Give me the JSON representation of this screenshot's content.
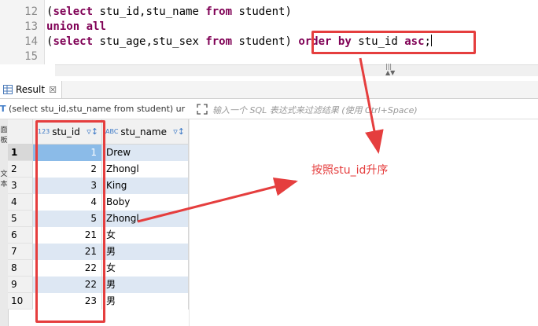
{
  "editor": {
    "lines": [
      {
        "num": "12",
        "parts": [
          {
            "t": "(",
            "k": false
          },
          {
            "t": "select",
            "k": true
          },
          {
            "t": " stu_id,stu_name ",
            "k": false
          },
          {
            "t": "from",
            "k": true
          },
          {
            "t": " student)",
            "k": false
          }
        ]
      },
      {
        "num": "13",
        "parts": [
          {
            "t": "union",
            "k": true
          },
          {
            "t": " ",
            "k": false
          },
          {
            "t": "all",
            "k": true
          }
        ]
      },
      {
        "num": "14",
        "parts": [
          {
            "t": "(",
            "k": false
          },
          {
            "t": "select",
            "k": true
          },
          {
            "t": " stu_age,stu_sex ",
            "k": false
          },
          {
            "t": "from",
            "k": true
          },
          {
            "t": " student) ",
            "k": false
          },
          {
            "t": "order",
            "k": true
          },
          {
            "t": " ",
            "k": false
          },
          {
            "t": "by",
            "k": true
          },
          {
            "t": " stu_id ",
            "k": false
          },
          {
            "t": "asc",
            "k": true
          },
          {
            "t": ";",
            "k": false
          }
        ]
      },
      {
        "num": "15",
        "parts": []
      }
    ],
    "scroll_marks": "|||\n▲▼"
  },
  "result_tab": {
    "label": "Result",
    "close_glyph": "☒"
  },
  "filter": {
    "query_text": "(select stu_id,stu_name from student) ur",
    "placeholder": "输入一个 SQL 表达式来过滤结果 (使用 Ctrl+Space)"
  },
  "side_strip": [
    "面板",
    "文本"
  ],
  "grid": {
    "columns": [
      {
        "label": "stu_id",
        "type_badge": "123"
      },
      {
        "label": "stu_name",
        "type_badge": "ABC"
      }
    ],
    "rows": [
      {
        "num": "1",
        "id": "1",
        "name": "Drew"
      },
      {
        "num": "2",
        "id": "2",
        "name": "Zhongl"
      },
      {
        "num": "3",
        "id": "3",
        "name": "King"
      },
      {
        "num": "4",
        "id": "4",
        "name": "Boby"
      },
      {
        "num": "5",
        "id": "5",
        "name": "Zhongl"
      },
      {
        "num": "6",
        "id": "21",
        "name": "女"
      },
      {
        "num": "7",
        "id": "21",
        "name": "男"
      },
      {
        "num": "8",
        "id": "22",
        "name": "女"
      },
      {
        "num": "9",
        "id": "22",
        "name": "男"
      },
      {
        "num": "10",
        "id": "23",
        "name": "男"
      }
    ]
  },
  "annotation": {
    "text": "按照stu_id升序",
    "color": "#e53e3e"
  }
}
